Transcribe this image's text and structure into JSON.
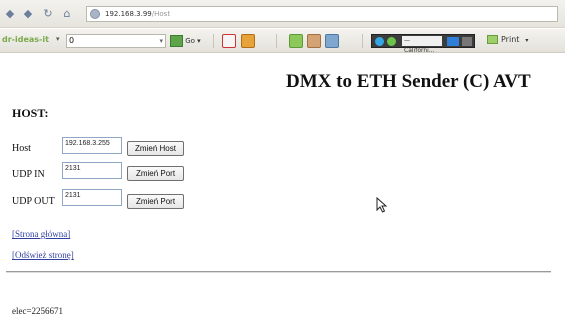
{
  "browser": {
    "address": "192.168.3.99",
    "address_path": "/Host",
    "toolbar_brand": "dr-ideas-it",
    "search_value": "0",
    "go_label": "Go",
    "weather_location": "— Californi...",
    "print_label": "Print"
  },
  "page": {
    "title": "DMX to ETH Sender (C) AVT",
    "heading": "HOST:",
    "rows": [
      {
        "label": "Host",
        "value": "192.168.3.255",
        "button": "Zmień Host"
      },
      {
        "label": "UDP IN",
        "value": "2131",
        "button": "Zmień Port"
      },
      {
        "label": "UDP OUT",
        "value": "2131",
        "button": "Zmień Port"
      }
    ],
    "links": [
      "[Strona główna]",
      "[Odśwież stronę]"
    ],
    "footer_text": "elec=2256671"
  }
}
